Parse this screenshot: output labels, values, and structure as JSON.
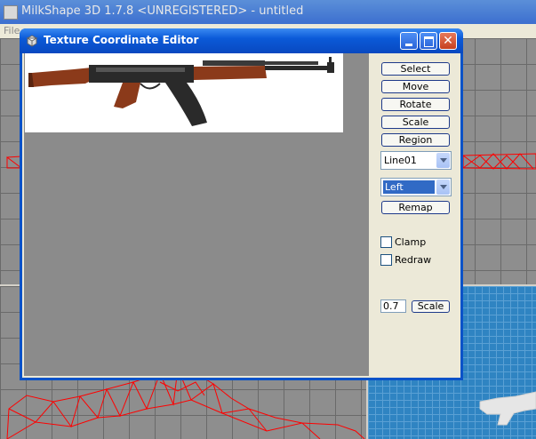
{
  "app": {
    "title": "MilkShape 3D 1.7.8 <UNREGISTERED> - untitled",
    "menu_file": "File"
  },
  "dialog": {
    "title": "Texture Coordinate Editor",
    "buttons": {
      "select": "Select",
      "move": "Move",
      "rotate": "Rotate",
      "scale": "Scale",
      "region": "Region",
      "remap": "Remap",
      "scale_value_button": "Scale"
    },
    "group_select": {
      "value": "Line01"
    },
    "view_select": {
      "value": "Left"
    },
    "checkboxes": {
      "clamp": {
        "label": "Clamp",
        "checked": false
      },
      "redraw": {
        "label": "Redraw",
        "checked": false
      }
    },
    "scale_value": "0.7"
  },
  "colors": {
    "titlebar": "#0b5ad8",
    "close_button": "#c6401f",
    "wireframe": "#ff0000",
    "viewport_3d": "#2f84c2"
  },
  "icons": [
    "app-icon",
    "dialog-icon",
    "minimize-icon",
    "maximize-icon",
    "close-icon",
    "chevron-down-icon"
  ]
}
